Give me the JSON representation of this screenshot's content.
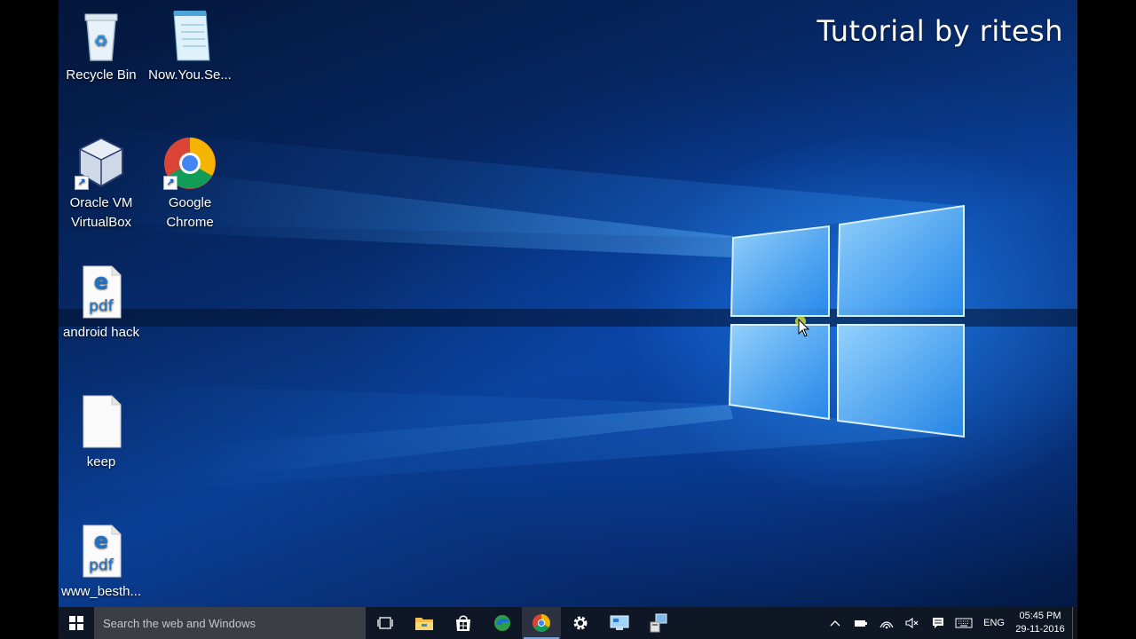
{
  "watermark": "Tutorial by ritesh",
  "desktop_icons": [
    {
      "label": "Recycle Bin",
      "icon": "recycle-bin-icon"
    },
    {
      "label": "Now.You.Se...",
      "icon": "notepad-file-icon"
    },
    {
      "label_line1": "Oracle VM",
      "label_line2": "VirtualBox",
      "icon": "virtualbox-icon"
    },
    {
      "label_line1": "Google",
      "label_line2": "Chrome",
      "icon": "chrome-icon"
    },
    {
      "label": "android hack",
      "icon": "edge-pdf-icon",
      "glyph_text": "pdf"
    },
    {
      "label": "keep",
      "icon": "blank-file-icon"
    },
    {
      "label": "www_besth...",
      "icon": "edge-pdf-icon",
      "glyph_text": "pdf"
    }
  ],
  "taskbar": {
    "search_placeholder": "Search the web and Windows",
    "pinned": [
      {
        "name": "task-view-icon"
      },
      {
        "name": "file-explorer-icon"
      },
      {
        "name": "store-icon"
      },
      {
        "name": "edge-sync-icon"
      },
      {
        "name": "chrome-icon",
        "active": true
      },
      {
        "name": "settings-gear-icon"
      },
      {
        "name": "remote-desktop-icon"
      },
      {
        "name": "network-tool-icon"
      }
    ],
    "tray": {
      "language": "ENG",
      "time": "05:45 PM",
      "date": "29-11-2016"
    }
  },
  "colors": {
    "taskbar_bg": "#101622",
    "search_bg": "#3b3e45",
    "wallpaper_accent": "#2a96ff"
  }
}
